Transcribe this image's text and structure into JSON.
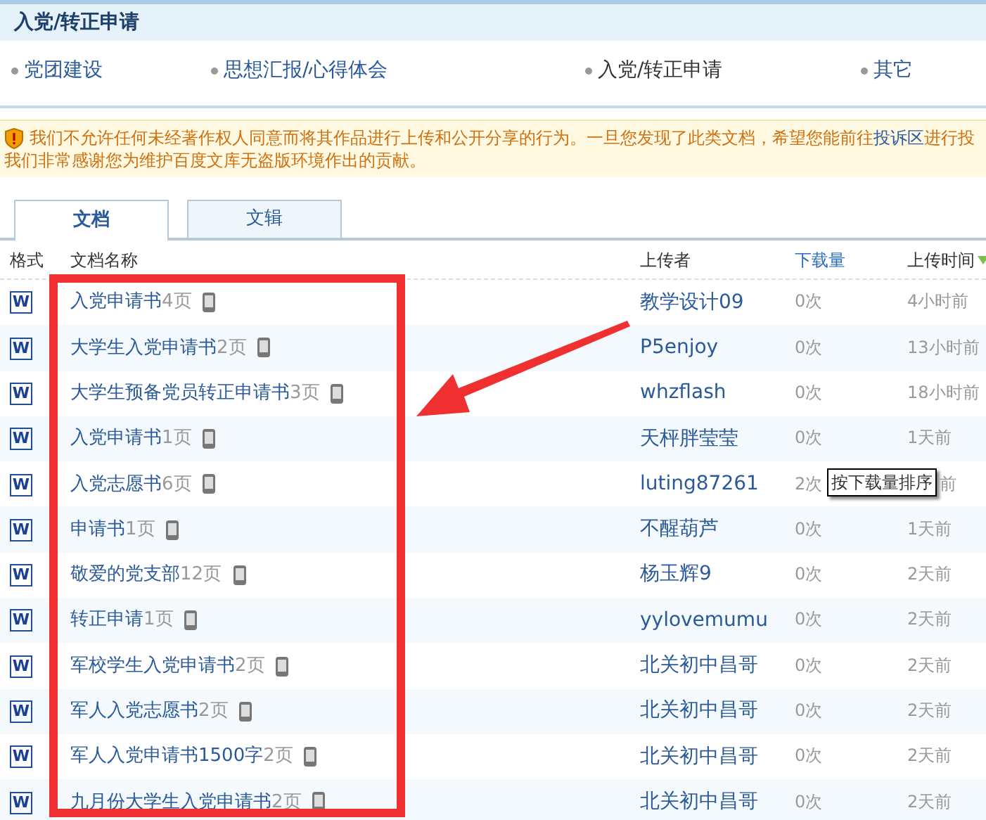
{
  "section_title": "入党/转正申请",
  "categories": [
    {
      "label": "党团建设",
      "selected": false
    },
    {
      "label": "思想汇报/心得体会",
      "selected": false
    },
    {
      "label": "入党/转正申请",
      "selected": true
    },
    {
      "label": "其它",
      "selected": false
    }
  ],
  "notice": {
    "lines": [
      "我们不允许任何未经著作权人同意而将其作品进行上传和公开分享的行为。一旦您发现了此类文档，希望您能前往",
      "我们非常感谢您为维护百度文库无盗版环境作出的贡献。"
    ],
    "link": "投诉区",
    "after_link": "进行投"
  },
  "tabs": [
    {
      "label": "文档",
      "selected": true
    },
    {
      "label": "文辑",
      "selected": false
    }
  ],
  "table": {
    "columns": [
      "格式",
      "文档名称",
      "上传者",
      "下载量",
      "上传时间"
    ],
    "rows": [
      {
        "format": "W",
        "title": "入党申请书",
        "pages": "4页",
        "uploader": "教学设计09",
        "downloads": "0次",
        "time": "4小时前"
      },
      {
        "format": "W",
        "title": "大学生入党申请书",
        "pages": "2页",
        "uploader": "P5enjoy",
        "downloads": "0次",
        "time": "13小时前"
      },
      {
        "format": "W",
        "title": "大学生预备党员转正申请书",
        "pages": "3页",
        "uploader": "whzflash",
        "downloads": "0次",
        "time": "18小时前"
      },
      {
        "format": "W",
        "title": "入党申请书",
        "pages": "1页",
        "uploader": "天枰胖莹莹",
        "downloads": "0次",
        "time": "1天前"
      },
      {
        "format": "W",
        "title": "入党志愿书",
        "pages": "6页",
        "uploader": "luting87261",
        "downloads": "2次",
        "time": "前"
      },
      {
        "format": "W",
        "title": "申请书",
        "pages": "1页",
        "uploader": "不醒葫芦",
        "downloads": "0次",
        "time": "1天前"
      },
      {
        "format": "W",
        "title": "敬爱的党支部",
        "pages": "12页",
        "uploader": "杨玉辉9",
        "downloads": "0次",
        "time": "2天前"
      },
      {
        "format": "W",
        "title": "转正申请",
        "pages": "1页",
        "uploader": "yylovemumu",
        "downloads": "0次",
        "time": "2天前"
      },
      {
        "format": "W",
        "title": "军校学生入党申请书",
        "pages": "2页",
        "uploader": "北关初中昌哥",
        "downloads": "0次",
        "time": "2天前"
      },
      {
        "format": "W",
        "title": "军人入党志愿书",
        "pages": "2页",
        "uploader": "北关初中昌哥",
        "downloads": "0次",
        "time": "2天前"
      },
      {
        "format": "W",
        "title": "军人入党申请书1500字",
        "pages": "2页",
        "uploader": "北关初中昌哥",
        "downloads": "0次",
        "time": "2天前"
      },
      {
        "format": "W",
        "title": "九月份大学生入党申请书",
        "pages": "2页",
        "uploader": "北关初中昌哥",
        "downloads": "0次",
        "time": "2天前"
      }
    ]
  },
  "tooltip": "按下载量排序",
  "annotations": {
    "highlight_box": true,
    "arrow": true
  }
}
